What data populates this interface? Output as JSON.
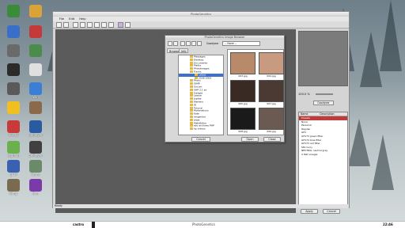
{
  "app": {
    "title": "PhotoGenetics",
    "menu": [
      "File",
      "Edit",
      "Help"
    ],
    "status": "Ready"
  },
  "desktop_icons": [
    {
      "label": "",
      "color": "#3a8c3a"
    },
    {
      "label": "",
      "color": "#d9a33a"
    },
    {
      "label": "",
      "color": "#3a6fc9"
    },
    {
      "label": "",
      "color": "#c43a3a"
    },
    {
      "label": "",
      "color": "#6a6a6a"
    },
    {
      "label": "",
      "color": "#4b8b4b"
    },
    {
      "label": "",
      "color": "#2b2b2b"
    },
    {
      "label": "",
      "color": "#e0e0e0"
    },
    {
      "label": "",
      "color": "#5a5a5a"
    },
    {
      "label": "Win",
      "color": "#3a7fd5"
    },
    {
      "label": "",
      "color": "#f0c020"
    },
    {
      "label": "",
      "color": "#8a6a4a"
    },
    {
      "label": "PixelD",
      "color": "#c83a3a"
    },
    {
      "label": "bePlayer",
      "color": "#2a5aa0"
    },
    {
      "label": "LeafPad",
      "color": "#6ab04c"
    },
    {
      "label": "bePlayer",
      "color": "#404040"
    },
    {
      "label": "bFTP",
      "color": "#3a60b0"
    },
    {
      "label": "Cams",
      "color": "#6a8a6a"
    },
    {
      "label": "Gimp",
      "color": "#7a6a50"
    },
    {
      "label": "Nvu",
      "color": "#7a3aa8"
    }
  ],
  "dialog": {
    "title": "PhotoGenetics Image Browser",
    "dropdown_label": "Goodyear",
    "dropdown_value": "-- None --",
    "tabs": [
      "Browse",
      "Info"
    ],
    "folders": [
      "Messages",
      "Desktop",
      "Documents",
      "Media",
      "PhotoImages",
      "Tracks",
      "Latest",
      "2006-2005",
      "Photo",
      "GIMP",
      "Xircom",
      "XHP 2.1 se",
      "Gadget",
      "Lesson",
      "Jupiter",
      "Markers",
      "ID",
      "Tutorial",
      "Moderations",
      "Kate",
      "rexgenlist",
      "www",
      "MathEditor",
      "ebc archives PHP",
      "hp videos"
    ],
    "thumbnails": [
      "003.jpg",
      "004.jpg",
      "005.jpg",
      "007.jpg",
      "008.jpg",
      "009.jpg"
    ],
    "thumb_colors": [
      "#b98a6a",
      "#c89a80",
      "#3a2a24",
      "#4a3a33",
      "#1a1a1a",
      "#6a5a52"
    ],
    "cancel_label": "Cancel",
    "open_label": "Open",
    "close_label": "Close"
  },
  "panel": {
    "zoom_value": "100.0 %",
    "layers_header_name": "Name",
    "layers_header_desc": "Description",
    "layers": [
      "Presets",
      "None",
      "Personal",
      "Regular",
      "GP1",
      "GFX73  green filter",
      "GFX74  blue filter",
      "GFX73  red filter",
      "Sfix  Ivory",
      "NEUTRAL  neutral grey",
      "2 Pelt  vinegar"
    ],
    "apply_label": "Apply",
    "cancel_label": "Cancel"
  },
  "taskbar": {
    "item": "castro",
    "center_label": "PhotoGenetics",
    "clock": "22:46"
  }
}
